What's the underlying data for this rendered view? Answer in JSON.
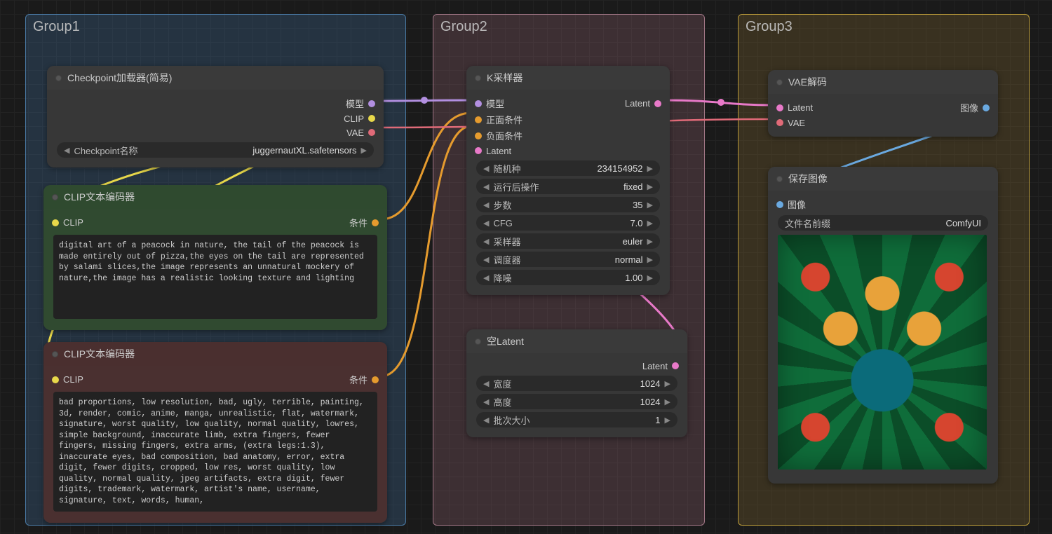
{
  "groups": {
    "g1": {
      "title": "Group1"
    },
    "g2": {
      "title": "Group2"
    },
    "g3": {
      "title": "Group3"
    }
  },
  "checkpoint": {
    "title": "Checkpoint加载器(简易)",
    "out_model": "模型",
    "out_clip": "CLIP",
    "out_vae": "VAE",
    "widget_label": "Checkpoint名称",
    "widget_value": "juggernautXL.safetensors"
  },
  "clip_pos": {
    "title": "CLIP文本编码器",
    "in_clip": "CLIP",
    "out_cond": "条件",
    "text": "digital art of a peacock in nature, the tail of the peacock is made entirely out of pizza,the eyes on the tail are represented by salami slices,the image represents an unnatural mockery of nature,the image has a realistic looking texture and lighting"
  },
  "clip_neg": {
    "title": "CLIP文本编码器",
    "in_clip": "CLIP",
    "out_cond": "条件",
    "text": "bad proportions, low resolution, bad, ugly, terrible, painting, 3d, render, comic, anime, manga, unrealistic, flat, watermark, signature, worst quality, low quality, normal quality, lowres, simple background, inaccurate limb, extra fingers, fewer fingers, missing fingers, extra arms, (extra legs:1.3), inaccurate eyes, bad composition, bad anatomy, error, extra digit, fewer digits, cropped, low res, worst quality, low quality, normal quality, jpeg artifacts, extra digit, fewer digits, trademark, watermark, artist's name, username, signature, text, words, human,"
  },
  "ksampler": {
    "title": "K采样器",
    "in_model": "模型",
    "in_pos": "正面条件",
    "in_neg": "负面条件",
    "in_latent": "Latent",
    "out_latent": "Latent",
    "seed_label": "随机种",
    "seed_value": "234154952",
    "after_label": "运行后操作",
    "after_value": "fixed",
    "steps_label": "步数",
    "steps_value": "35",
    "cfg_label": "CFG",
    "cfg_value": "7.0",
    "sampler_label": "采样器",
    "sampler_value": "euler",
    "sched_label": "调度器",
    "sched_value": "normal",
    "denoise_label": "降噪",
    "denoise_value": "1.00"
  },
  "empty_latent": {
    "title": "空Latent",
    "out_latent": "Latent",
    "w_label": "宽度",
    "w_value": "1024",
    "h_label": "高度",
    "h_value": "1024",
    "b_label": "批次大小",
    "b_value": "1"
  },
  "vae_decode": {
    "title": "VAE解码",
    "in_latent": "Latent",
    "in_vae": "VAE",
    "out_image": "图像"
  },
  "save_image": {
    "title": "保存图像",
    "in_image": "图像",
    "prefix_label": "文件名前缀",
    "prefix_value": "ComfyUI"
  }
}
